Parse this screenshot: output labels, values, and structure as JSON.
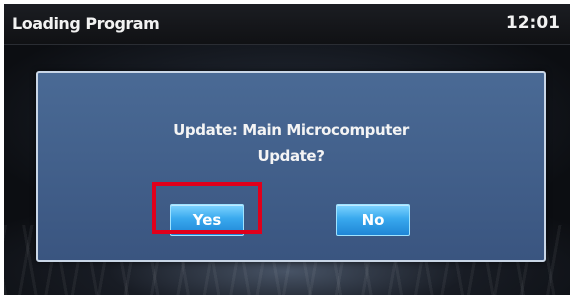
{
  "header": {
    "title": "Loading Program",
    "clock": "12:01"
  },
  "dialog": {
    "message_line1": "Update: Main Microcomputer",
    "message_line2": "Update?",
    "buttons": {
      "yes_label": "Yes",
      "no_label": "No"
    }
  },
  "annotation": {
    "highlight_color": "#e0001b",
    "highlighted_button": "Yes"
  },
  "colors": {
    "dialog_background": "#43618c",
    "button_accent": "#39a9ee",
    "text": "#f4f4f4"
  }
}
